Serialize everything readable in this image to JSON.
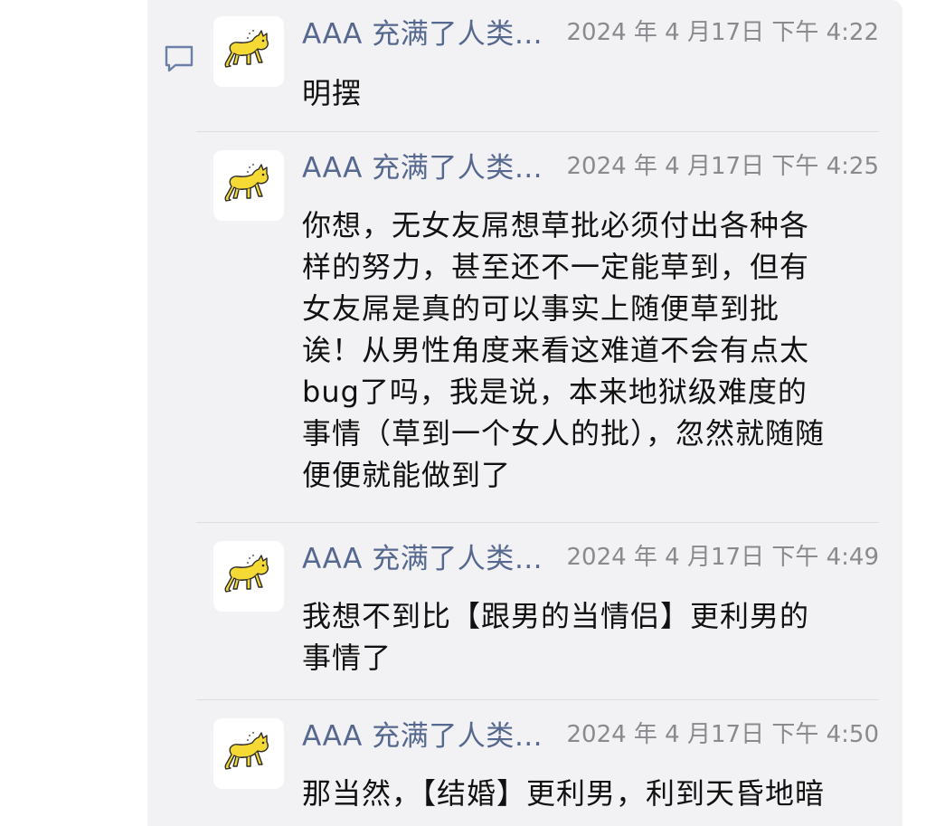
{
  "icons": {
    "comment": "comment-icon",
    "avatar": "yellow-cat-icon"
  },
  "colors": {
    "panel_bg": "#f2f2f4",
    "name": "#56688f",
    "time": "#8a8a8e",
    "text": "#111111",
    "avatar_cat": "#f5d935"
  },
  "messages": [
    {
      "name": "AAA 充满了人类…",
      "time": "2024 年 4 月17日 下午 4:22",
      "lines": [
        "明摆"
      ]
    },
    {
      "name": "AAA 充满了人类…",
      "time": "2024 年 4 月17日 下午 4:25",
      "lines": [
        "你想，无女友屌想草批必须付出各种各",
        "样的努力，甚至还不一定能草到，但有",
        "女友屌是真的可以事实上随便草到批",
        "诶！从男性角度来看这难道不会有点太",
        "bug了吗，我是说，本来地狱级难度的",
        "事情（草到一个女人的批），忽然就随随",
        "便便就能做到了"
      ]
    },
    {
      "name": "AAA 充满了人类…",
      "time": "2024 年 4 月17日 下午 4:49",
      "lines": [
        "我想不到比【跟男的当情侣】更利男的",
        "事情了"
      ]
    },
    {
      "name": "AAA 充满了人类…",
      "time": "2024 年 4 月17日 下午 4:50",
      "lines": [
        "那当然，【结婚】更利男，利到天昏地暗"
      ]
    }
  ]
}
